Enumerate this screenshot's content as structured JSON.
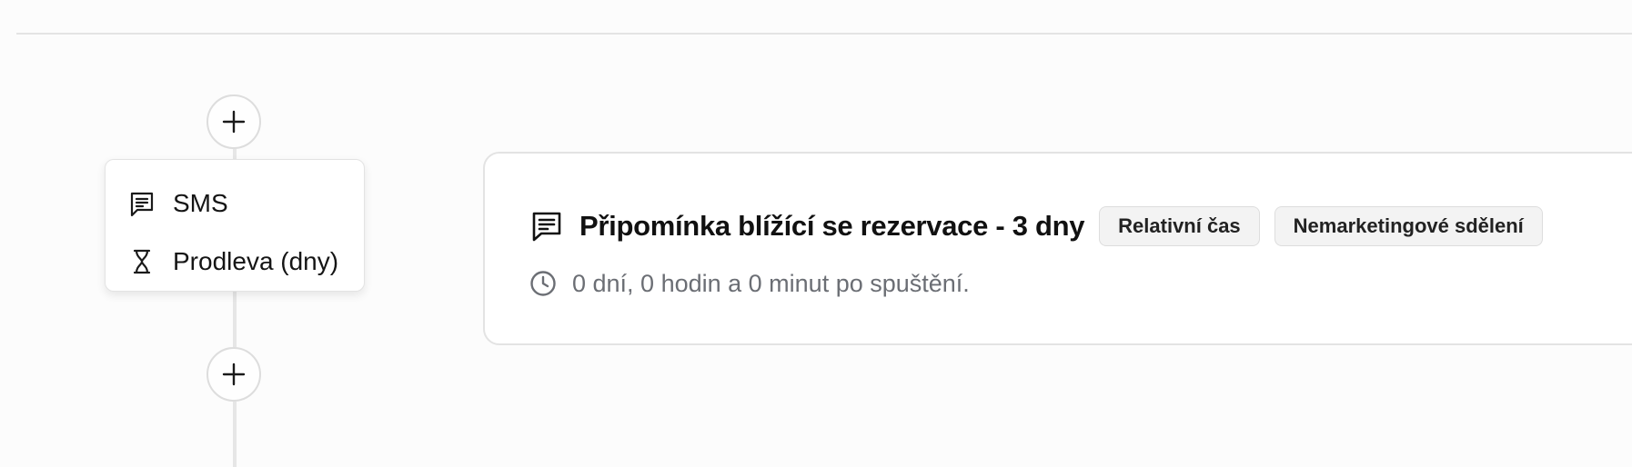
{
  "step_menu": {
    "items": [
      {
        "label": "SMS",
        "icon": "message-icon"
      },
      {
        "label": "Prodleva (dny)",
        "icon": "hourglass-icon"
      }
    ]
  },
  "flow": {
    "add_step_icon": "plus-icon"
  },
  "card": {
    "icon": "message-icon",
    "title": "Připomínka blížící se rezervace - 3 dny",
    "badges": [
      "Relativní čas",
      "Nemarketingové sdělení"
    ],
    "subtitle_icon": "clock-icon",
    "subtitle": "0 dní, 0 hodin a 0 minut po spuštění."
  },
  "colors": {
    "text": "#111111",
    "muted": "#6b6e74",
    "border": "#e3e3e3",
    "badge_bg": "#f3f3f3"
  }
}
